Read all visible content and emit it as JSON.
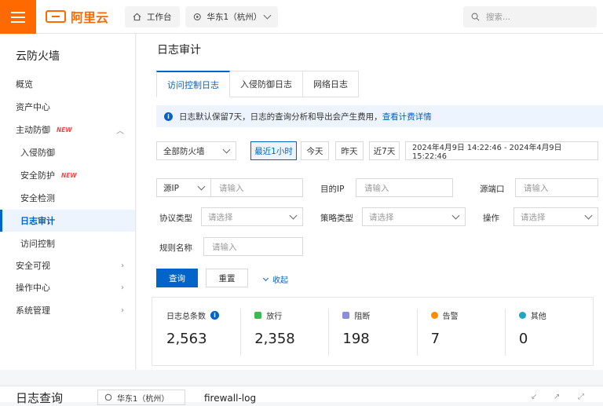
{
  "topbar": {
    "brand": "阿里云",
    "workbench": "工作台",
    "region": "华东1（杭州）",
    "search_placeholder": "搜索..."
  },
  "sidebar": {
    "title": "云防火墙",
    "items": [
      {
        "label": "概览"
      },
      {
        "label": "资产中心"
      },
      {
        "label": "主动防御",
        "badge": "NEW"
      },
      {
        "label": "入侵防御"
      },
      {
        "label": "安全防护",
        "badge": "NEW"
      },
      {
        "label": "安全检测"
      },
      {
        "label": "日志审计"
      },
      {
        "label": "访问控制"
      },
      {
        "label": "安全可视"
      },
      {
        "label": "操作中心"
      },
      {
        "label": "系统管理"
      }
    ]
  },
  "main": {
    "title": "日志审计",
    "tabs": [
      {
        "label": "访问控制日志"
      },
      {
        "label": "入侵防御日志"
      },
      {
        "label": "网络日志"
      }
    ],
    "notice": {
      "text": "日志默认保留7天，日志的查询分析和导出会产生费用，",
      "link": "查看计费详情"
    },
    "filters": {
      "firewall": "全部防火墙",
      "quick_ranges": [
        "最近1小时",
        "今天",
        "昨天",
        "近7天"
      ],
      "date_range": "2024年4月9日 14:22:46 - 2024年4月9日 15:22:46",
      "src_ip_select": "源IP",
      "input_placeholder": "请输入",
      "select_placeholder": "请选择",
      "dst_ip_label": "目的IP",
      "src_port_label": "源端口",
      "protocol_label": "协议类型",
      "policy_label": "策略类型",
      "action_label": "操作",
      "rule_label": "规则名称",
      "query_button": "查询",
      "reset_button": "重置",
      "collapse_label": "收起"
    },
    "stats": [
      {
        "label": "日志总条数",
        "value": "2,563",
        "color": "#0064c8"
      },
      {
        "label": "放行",
        "value": "2,358",
        "color": "#3fb950"
      },
      {
        "label": "阻断",
        "value": "198",
        "color": "#8b8fd6"
      },
      {
        "label": "告警",
        "value": "7",
        "color": "#ff8a00"
      },
      {
        "label": "其他",
        "value": "0",
        "color": "#1aa8c7"
      }
    ]
  },
  "bottom_window": {
    "title": "日志查询",
    "region": "华东1（杭州）",
    "logstore": "firewall-log"
  },
  "colors": {
    "brand": "#ff6a00",
    "accent": "#0064c8",
    "new_badge": "#f54743"
  }
}
